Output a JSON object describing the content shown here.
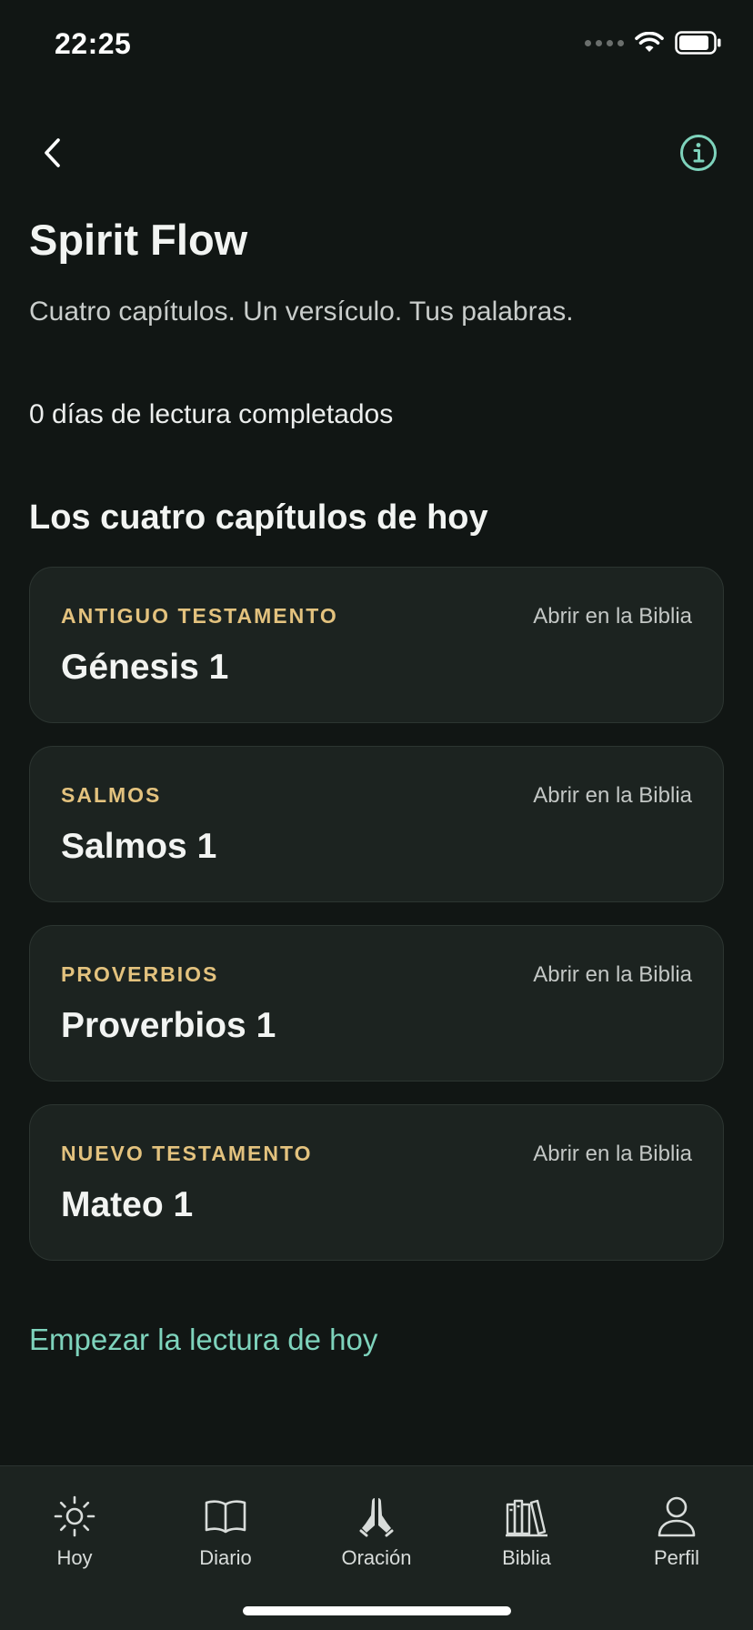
{
  "status_bar": {
    "time": "22:25"
  },
  "header": {
    "back_icon": "chevron-left-icon",
    "info_icon": "info-circle-icon",
    "title": "Spirit Flow",
    "subtitle": "Cuatro capítulos. Un versículo. Tus palabras.",
    "stat": "0 días de lectura completados"
  },
  "section_title": "Los cuatro capítulos de hoy",
  "chapters": [
    {
      "label": "ANTIGUO TESTAMENTO",
      "title": "Génesis 1",
      "link": "Abrir en la Biblia"
    },
    {
      "label": "SALMOS",
      "title": "Salmos 1",
      "link": "Abrir en la Biblia"
    },
    {
      "label": "PROVERBIOS",
      "title": "Proverbios 1",
      "link": "Abrir en la Biblia"
    },
    {
      "label": "NUEVO TESTAMENTO",
      "title": "Mateo 1",
      "link": "Abrir en la Biblia"
    }
  ],
  "start_link": "Empezar la lectura de hoy",
  "tabs": [
    {
      "label": "Hoy",
      "icon": "sun-icon"
    },
    {
      "label": "Diario",
      "icon": "open-book-icon"
    },
    {
      "label": "Oración",
      "icon": "praying-hands-icon"
    },
    {
      "label": "Biblia",
      "icon": "books-icon"
    },
    {
      "label": "Perfil",
      "icon": "person-icon"
    }
  ],
  "colors": {
    "background": "#111614",
    "card": "#1c2320",
    "accent_gold": "#e3c27e",
    "accent_mint": "#7ed3bc"
  }
}
